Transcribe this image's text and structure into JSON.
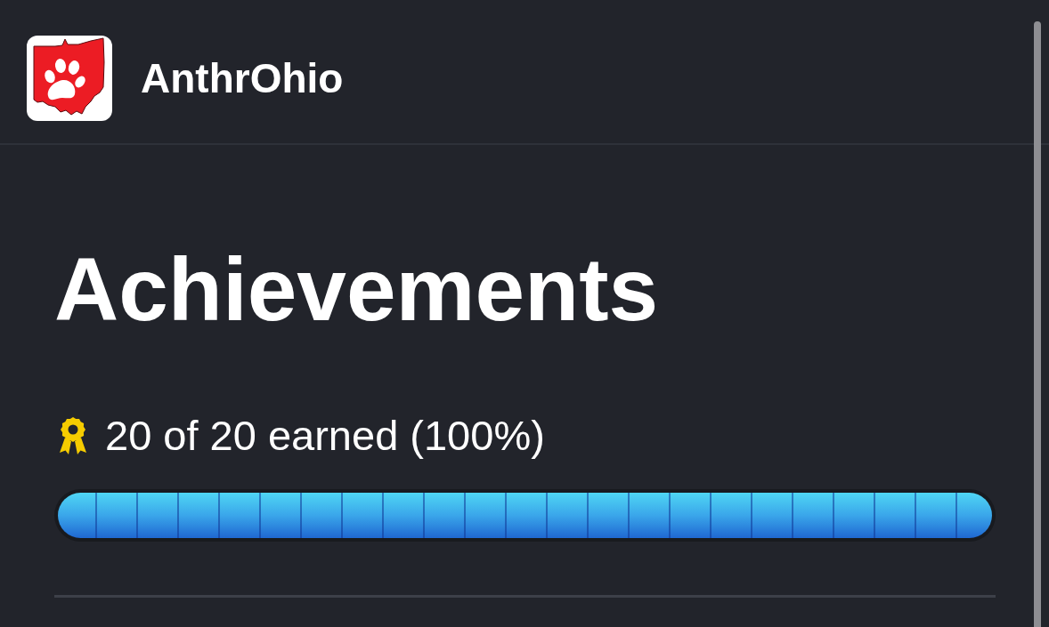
{
  "header": {
    "title": "AnthrOhio"
  },
  "page": {
    "title": "Achievements"
  },
  "progress": {
    "summary": "20 of 20 earned (100%)",
    "level": 1
  }
}
